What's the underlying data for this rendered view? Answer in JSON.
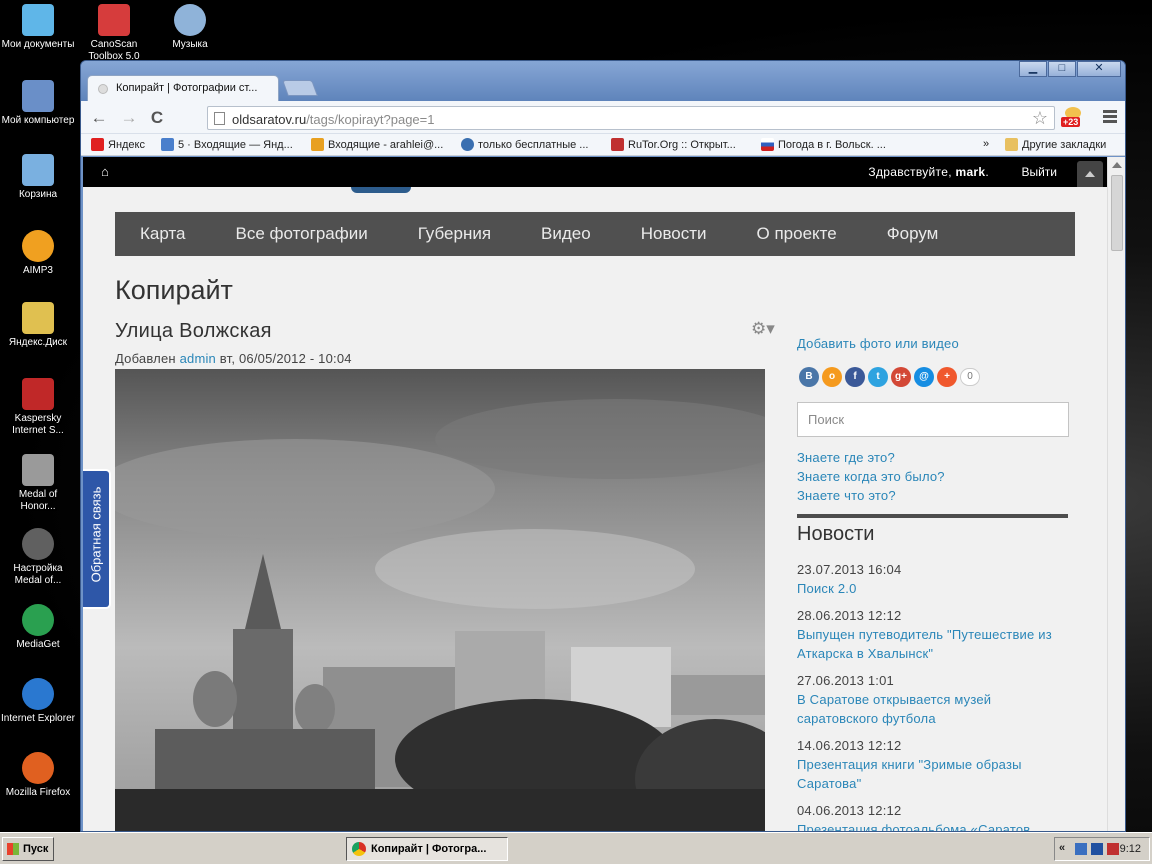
{
  "desktop": {
    "icons": [
      {
        "label": "Мои документы",
        "color": "#5fb6e8"
      },
      {
        "label": "CanoScan Toolbox 5.0",
        "color": "#d63c3c"
      },
      {
        "label": "Музыка",
        "color": "#8fb3d9"
      },
      {
        "label": "Мой компьютер",
        "color": "#6a8fc8"
      },
      {
        "label": "Корзина",
        "color": "#7ab0e0"
      },
      {
        "label": "AIMP3",
        "color": "#f0a020"
      },
      {
        "label": "Яндекс.Диск",
        "color": "#e0c050"
      },
      {
        "label": "Kaspersky Internet S...",
        "color": "#c02828"
      },
      {
        "label": "Medal of Honor...",
        "color": "#9a9a9a"
      },
      {
        "label": "Настройка Medal of...",
        "color": "#606060"
      },
      {
        "label": "MediaGet",
        "color": "#2aa050"
      },
      {
        "label": "Internet Explorer",
        "color": "#2a78d0"
      },
      {
        "label": "Mozilla Firefox",
        "color": "#e06020"
      }
    ]
  },
  "browser": {
    "tab_title": "Копирайт | Фотографии ст...",
    "window_buttons": {
      "minimize": "▁",
      "maximize": "□",
      "close": "✕"
    },
    "nav": {
      "back": "←",
      "forward": "→",
      "reload": "C"
    },
    "url_host": "oldsaratov.ru",
    "url_path": "/tags/kopirayt?page=1",
    "star": "☆",
    "ext_badge": "+23",
    "bookmarks": [
      {
        "label": "Яндекс",
        "color": "#e02020"
      },
      {
        "label": "5 · Входящие — Янд...",
        "color": "#4a7fcc"
      },
      {
        "label": "Входящие - arahlei@...",
        "color": "#e8a020"
      },
      {
        "label": "только бесплатные ...",
        "color": "#3a6fb0"
      },
      {
        "label": "RuTor.Org :: Открыт...",
        "color": "#c03030"
      },
      {
        "label": "Погода в г. Вольск. ...",
        "color": "#3060c0"
      }
    ],
    "bookmarks_more": "»",
    "other_bookmarks": "Другие закладки"
  },
  "site": {
    "top": {
      "home": "⌂",
      "greeting": "Здравствуйте, ",
      "user": "mark",
      "greeting_end": ".",
      "logout": "Выйти"
    },
    "nav": [
      "Карта",
      "Все фотографии",
      "Губерния",
      "Видео",
      "Новости",
      "О проекте",
      "Форум"
    ],
    "page_title": "Копирайт",
    "post_title": "Улица Волжская",
    "gear": "⚙▾",
    "byline_prefix": "Добавлен ",
    "author": "admin",
    "byline_date": " вт, 06/05/2012 - 10:04",
    "feedback": "Обратная связь"
  },
  "sidebar": {
    "add_link": "Добавить фото или видео",
    "share": [
      {
        "label": "В",
        "color": "#4a76a8"
      },
      {
        "label": "о",
        "color": "#f59a1e"
      },
      {
        "label": "f",
        "color": "#3b5998"
      },
      {
        "label": "t",
        "color": "#2ea3e0"
      },
      {
        "label": "g+",
        "color": "#d34836"
      },
      {
        "label": "@",
        "color": "#168de2"
      },
      {
        "label": "+",
        "color": "#f0582d"
      }
    ],
    "share_count": "0",
    "search_placeholder": "Поиск",
    "questions": [
      "Знаете где это?",
      "Знаете когда это было?",
      "Знаете что это?"
    ],
    "news_heading": "Новости",
    "news": [
      {
        "date": "23.07.2013 16:04",
        "title": "Поиск 2.0"
      },
      {
        "date": "28.06.2013 12:12",
        "title": "Выпущен путеводитель \"Путешествие из Аткарска в Хвалынск\""
      },
      {
        "date": "27.06.2013 1:01",
        "title": "В Саратове открывается музей саратовского футбола"
      },
      {
        "date": "14.06.2013 12:12",
        "title": "Презентация книги \"Зримые образы Саратова\""
      },
      {
        "date": "04.06.2013 12:12",
        "title": "Презентация фотоальбома «Саратов Германа Рассветова»"
      }
    ]
  },
  "taskbar": {
    "start": "Пуск",
    "task": "Копирайт | Фотогра...",
    "tray_chevron": "«",
    "clock": "9:12"
  }
}
